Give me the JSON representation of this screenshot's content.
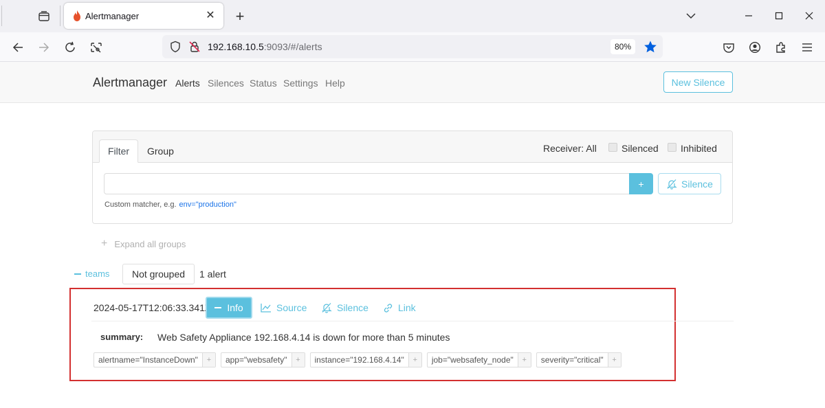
{
  "browser": {
    "tab_title": "Alertmanager",
    "url_host": "192.168.10.5",
    "url_rest": ":9093/#/alerts",
    "zoom": "80%"
  },
  "app": {
    "brand": "Alertmanager",
    "nav": [
      "Alerts",
      "Silences",
      "Status",
      "Settings",
      "Help"
    ],
    "new_silence": "New Silence"
  },
  "filter": {
    "tabs": [
      "Filter",
      "Group"
    ],
    "receiver": "Receiver: All",
    "silenced_label": "Silenced",
    "inhibited_label": "Inhibited",
    "input_value": "",
    "plus": "+",
    "silence_btn": "Silence",
    "hint_text": "Custom matcher, e.g.",
    "hint_code": "env=\"production\""
  },
  "expand_all": "Expand all groups",
  "group": {
    "name": "teams",
    "label": "Not grouped",
    "count": "1 alert"
  },
  "alert": {
    "timestamp": "2024-05-17T12:06:33.341Z",
    "info": "Info",
    "source": "Source",
    "silence": "Silence",
    "link": "Link",
    "summary_key": "summary:",
    "summary_val": "Web Safety Appliance 192.168.4.14 is down for more than 5 minutes",
    "labels": [
      "alertname=\"InstanceDown\"",
      "app=\"websafety\"",
      "instance=\"192.168.4.14\"",
      "job=\"websafety_node\"",
      "severity=\"critical\""
    ]
  },
  "colors": {
    "accent": "#5bc0de",
    "highlight_border": "#d32f2f",
    "bookmark_star": "#0060df"
  }
}
